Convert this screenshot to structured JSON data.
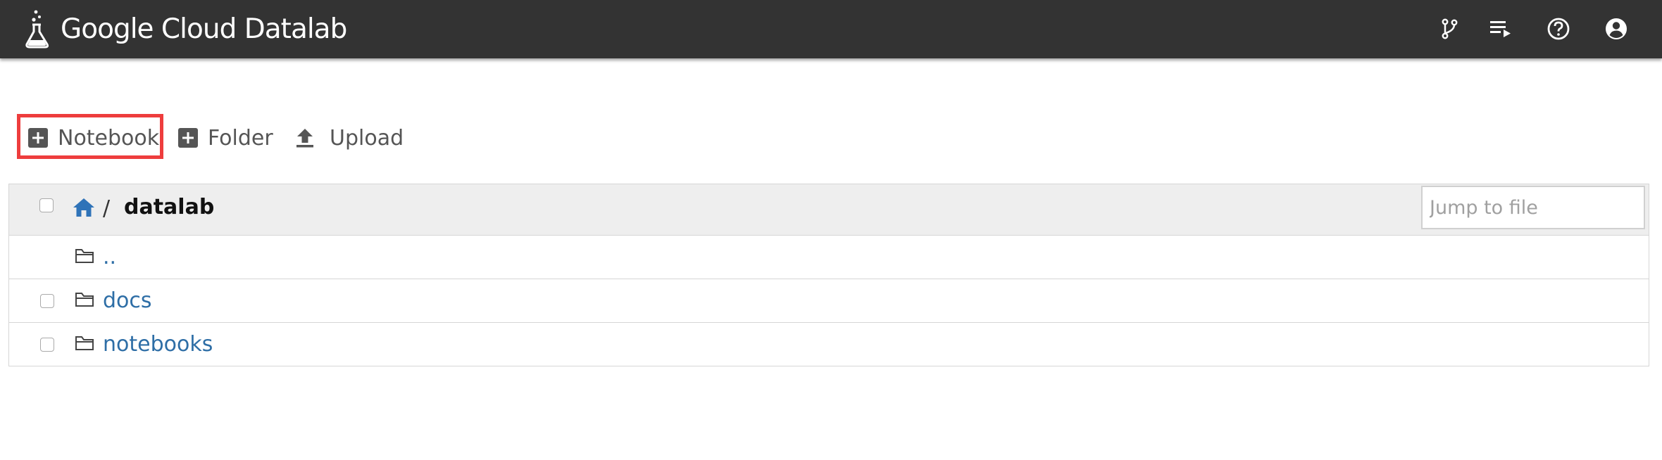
{
  "header": {
    "brand": "Google Cloud Datalab",
    "icons": [
      "git-branch-icon",
      "playlist-icon",
      "help-icon",
      "account-icon"
    ]
  },
  "toolbar": {
    "notebook_label": "Notebook",
    "folder_label": "Folder",
    "upload_label": "Upload"
  },
  "breadcrumb": {
    "separator": "/",
    "current": "datalab"
  },
  "search": {
    "placeholder": "Jump to file"
  },
  "files": [
    {
      "name": "..",
      "type": "folder"
    },
    {
      "name": "docs",
      "type": "folder"
    },
    {
      "name": "notebooks",
      "type": "folder"
    }
  ],
  "colors": {
    "header_bg": "#333333",
    "link": "#2e6ea6",
    "home_icon": "#2f73b8",
    "highlight": "#ee3d3d"
  }
}
